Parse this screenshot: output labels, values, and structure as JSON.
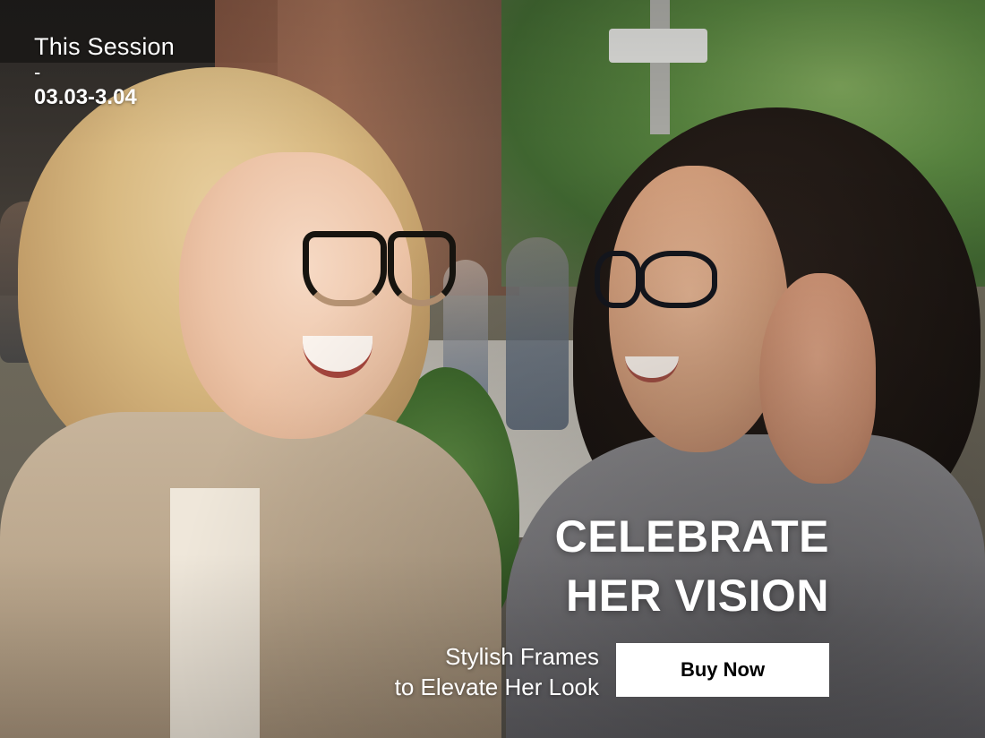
{
  "session": {
    "label": "This Session",
    "separator": "-",
    "dates": "03.03-3.04"
  },
  "headline": {
    "line1": "CELEBRATE",
    "line2": "HER VISION"
  },
  "subhead": {
    "line1": "Stylish Frames",
    "line2": "to Elevate Her Look"
  },
  "cta": {
    "label": "Buy Now"
  },
  "colors": {
    "text": "#ffffff",
    "button_bg": "#ffffff",
    "button_text": "#000000"
  }
}
